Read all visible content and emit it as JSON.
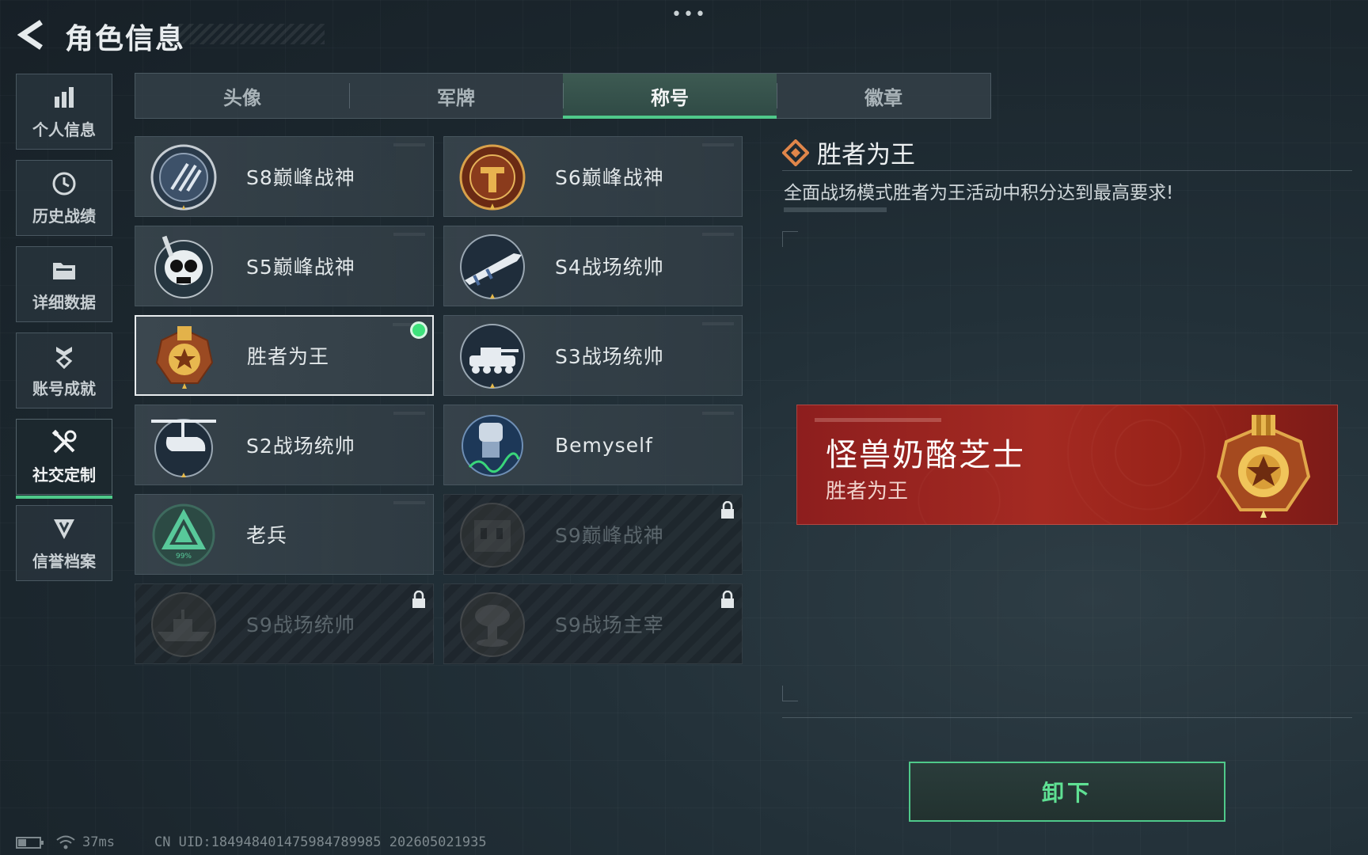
{
  "header": {
    "title": "角色信息",
    "more": "•••"
  },
  "sidebar": {
    "items": [
      {
        "label": "个人信息",
        "icon": "bar-chart-icon",
        "active": false
      },
      {
        "label": "历史战绩",
        "icon": "history-clock-icon",
        "active": false
      },
      {
        "label": "详细数据",
        "icon": "folder-icon",
        "active": false
      },
      {
        "label": "账号成就",
        "icon": "achievement-icon",
        "active": false
      },
      {
        "label": "社交定制",
        "icon": "wrench-screwdriver-icon",
        "active": true
      },
      {
        "label": "信誉档案",
        "icon": "credit-shield-icon",
        "active": false
      }
    ]
  },
  "tabs": [
    {
      "label": "头像",
      "active": false
    },
    {
      "label": "军牌",
      "active": false
    },
    {
      "label": "称号",
      "active": true
    },
    {
      "label": "徽章",
      "active": false
    }
  ],
  "titles": [
    {
      "label": "S8巅峰战神",
      "icon": "s8-emblem-icon",
      "state": "unlocked"
    },
    {
      "label": "S6巅峰战神",
      "icon": "s6-emblem-icon",
      "state": "unlocked"
    },
    {
      "label": "S5巅峰战神",
      "icon": "skull-emblem-icon",
      "state": "unlocked"
    },
    {
      "label": "S4战场统帅",
      "icon": "missile-emblem-icon",
      "state": "unlocked"
    },
    {
      "label": "胜者为王",
      "icon": "gold-star-medal-icon",
      "state": "selected"
    },
    {
      "label": "S3战场统帅",
      "icon": "tank-emblem-icon",
      "state": "unlocked"
    },
    {
      "label": "S2战场统帅",
      "icon": "helicopter-emblem-icon",
      "state": "unlocked"
    },
    {
      "label": "Bemyself",
      "icon": "signature-emblem-icon",
      "state": "unlocked"
    },
    {
      "label": "老兵",
      "icon": "veteran-triangle-icon",
      "badge_text": "99%",
      "state": "unlocked"
    },
    {
      "label": "S9巅峰战神",
      "icon": "building-emblem-icon",
      "state": "locked"
    },
    {
      "label": "S9战场统帅",
      "icon": "warship-emblem-icon",
      "state": "locked"
    },
    {
      "label": "S9战场主宰",
      "icon": "mushroom-cloud-emblem-icon",
      "state": "locked"
    }
  ],
  "detail": {
    "name": "胜者为王",
    "description": "全面战场模式胜者为王活动中积分达到最高要求!"
  },
  "banner": {
    "player_name": "怪兽奶酪芝士",
    "title": "胜者为王"
  },
  "actions": {
    "unequip_label": "卸下"
  },
  "status": {
    "ping": "37ms",
    "uid": "CN UID:184948401475984789985 202605021935"
  },
  "colors": {
    "accent_green": "#4fc98a",
    "banner_red": "#a42a22",
    "selected_dot": "#3ee27c"
  }
}
